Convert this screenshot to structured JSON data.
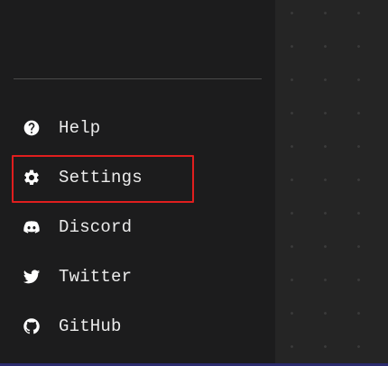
{
  "menu": {
    "items": [
      {
        "label": "Help",
        "icon": "help-circle-icon"
      },
      {
        "label": "Settings",
        "icon": "gear-icon"
      },
      {
        "label": "Discord",
        "icon": "discord-icon"
      },
      {
        "label": "Twitter",
        "icon": "twitter-icon"
      },
      {
        "label": "GitHub",
        "icon": "github-icon"
      }
    ]
  },
  "colors": {
    "sidebar_background": "#1c1c1d",
    "canvas_background": "#252525",
    "highlight": "#e01e1e",
    "text": "#ececec"
  }
}
